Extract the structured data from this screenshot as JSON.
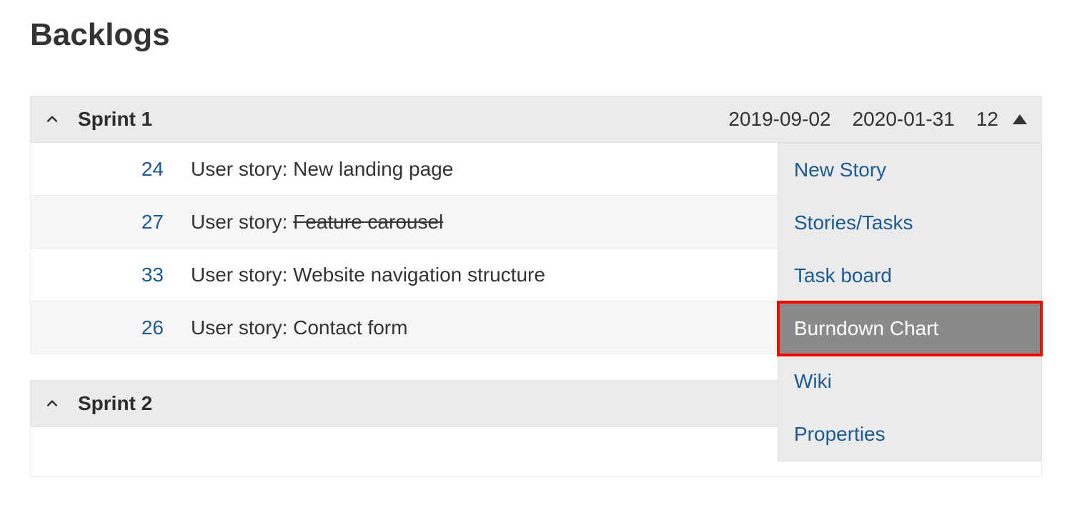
{
  "page": {
    "title": "Backlogs"
  },
  "sprint1": {
    "name": "Sprint 1",
    "start_date": "2019-09-02",
    "end_date": "2020-01-31",
    "points": "12",
    "stories": [
      {
        "id": "24",
        "prefix": "User story: ",
        "body": "New landing page",
        "struck": false
      },
      {
        "id": "27",
        "prefix": "User story: ",
        "body": "Feature carousel",
        "struck": true
      },
      {
        "id": "33",
        "prefix": "User story: ",
        "body": "Website navigation structure",
        "struck": false
      },
      {
        "id": "26",
        "prefix": "User story: ",
        "body": "Contact form",
        "struck": false
      }
    ]
  },
  "sprint2": {
    "name": "Sprint 2"
  },
  "menu": {
    "items": [
      {
        "label": "New Story",
        "highlighted": false
      },
      {
        "label": "Stories/Tasks",
        "highlighted": false
      },
      {
        "label": "Task board",
        "highlighted": false
      },
      {
        "label": "Burndown Chart",
        "highlighted": true
      },
      {
        "label": "Wiki",
        "highlighted": false
      },
      {
        "label": "Properties",
        "highlighted": false
      }
    ]
  }
}
